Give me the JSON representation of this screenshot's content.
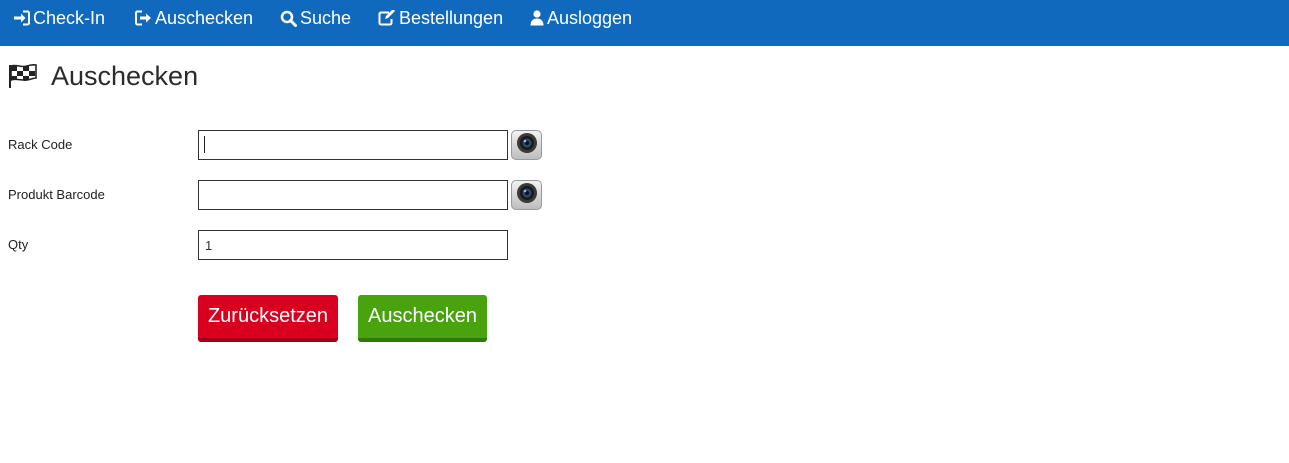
{
  "nav": {
    "items": [
      {
        "label": "Check-In",
        "icon": "sign-in-icon"
      },
      {
        "label": "Auschecken",
        "icon": "sign-out-icon"
      },
      {
        "label": "Suche",
        "icon": "search-icon"
      },
      {
        "label": "Bestellungen",
        "icon": "edit-icon"
      },
      {
        "label": "Ausloggen",
        "icon": "user-icon"
      }
    ],
    "background_color": "#1069bd"
  },
  "page": {
    "title": "Auschecken",
    "title_icon": "checkered-flag-icon"
  },
  "form": {
    "rack_code": {
      "label": "Rack Code",
      "value": ""
    },
    "product_barcode": {
      "label": "Produkt Barcode",
      "value": ""
    },
    "qty": {
      "label": "Qty",
      "value": "1"
    }
  },
  "buttons": {
    "reset_label": "Zurücksetzen",
    "reset_color": "#d8001e",
    "checkout_label": "Auschecken",
    "checkout_color": "#48a30f",
    "camera_icon": "camera-icon"
  }
}
